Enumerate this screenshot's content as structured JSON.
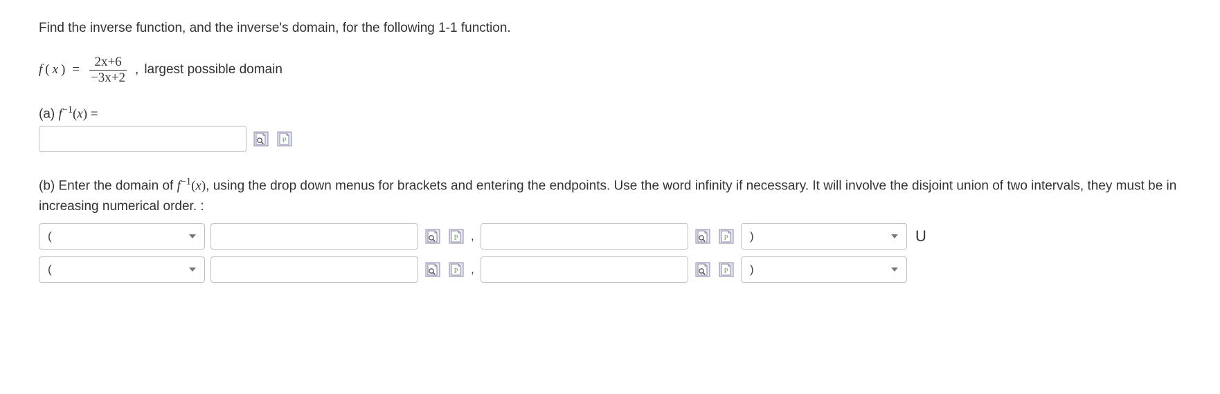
{
  "intro_text": "Find the inverse function, and the inverse's domain, for the following 1-1 function.",
  "function": {
    "lhs_f": "f",
    "lhs_paren_open": "(",
    "lhs_x": "x",
    "lhs_paren_close": ")",
    "eq": "=",
    "numerator": "2x+6",
    "denominator": "−3x+2",
    "trail_comma": ",",
    "trail_text": "largest possible domain"
  },
  "part_a": {
    "label_prefix": "(a) ",
    "f": "f",
    "exp": "−1",
    "paren_open": "(",
    "x": "x",
    "paren_close": ")",
    "eq": " ="
  },
  "part_b": {
    "text_prefix": "(b) Enter the domain of ",
    "f": "f",
    "exp": "−1",
    "paren_open": "(",
    "x": "x",
    "paren_close": ")",
    "text_suffix": ", using the drop down menus for brackets and entering the endpoints. Use the word infinity if necessary. It will involve the disjoint union of two intervals, they must be in increasing numerical order. :"
  },
  "selects": {
    "open1": "(",
    "close1": ")",
    "open2": "(",
    "close2": ")"
  },
  "separators": {
    "comma": ",",
    "union": "U"
  }
}
